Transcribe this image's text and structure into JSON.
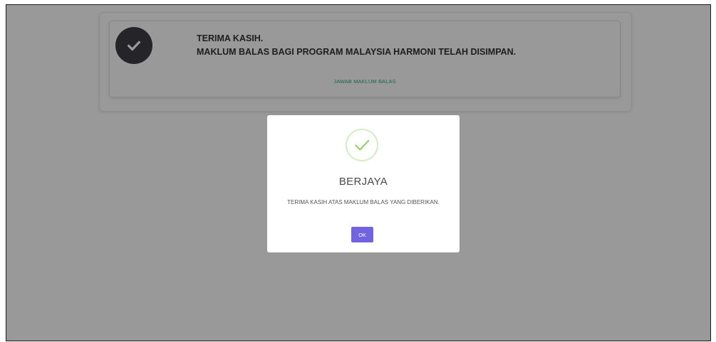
{
  "feedback_card": {
    "thanks_line": "TERIMA KASIH.",
    "saved_line": "MAKLUM BALAS BAGI PROGRAM MALAYSIA HARMONI TELAH DISIMPAN.",
    "answer_link_label": "JAWAB MAKLUM BALAS"
  },
  "modal": {
    "icon": "success-check-icon",
    "title": "BERJAYA",
    "message": "TERIMA KASIH ATAS MAKLUM BALAS YANG DIBERIKAN.",
    "ok_label": "OK"
  },
  "colors": {
    "overlay": "#000000",
    "ok_button": "#7264e0",
    "success_check": "#8fd16a",
    "link": "#34a58b",
    "dark_badge": "#3f3f45"
  }
}
